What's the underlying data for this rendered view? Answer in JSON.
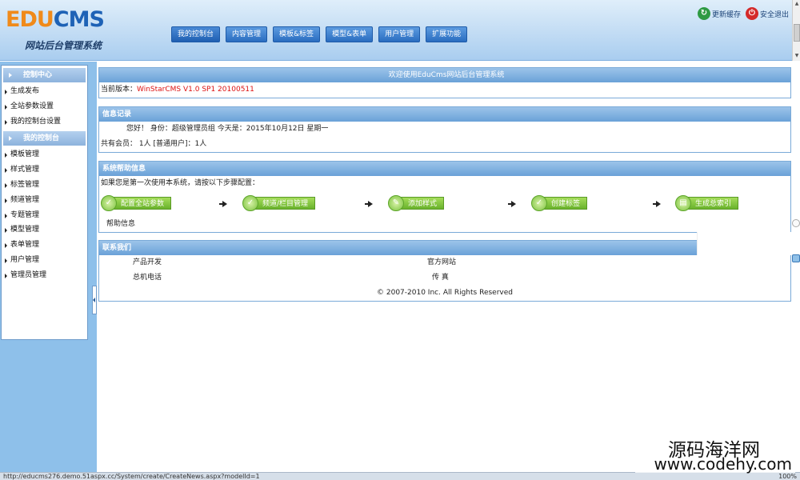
{
  "header": {
    "logo_edu": "EDU",
    "logo_cms": "CMS",
    "subtitle": "网站后台管理系统",
    "nav": [
      "我的控制台",
      "内容管理",
      "模板&标签",
      "模型&表单",
      "用户管理",
      "扩展功能"
    ],
    "refresh_label": "更新缓存",
    "logout_label": "安全退出",
    "refresh_icon": "refresh-icon",
    "logout_icon": "power-icon"
  },
  "sidebar": {
    "section1_title": "控制中心",
    "section1_items": [
      "生成发布",
      "全站参数设置",
      "我的控制台设置"
    ],
    "section2_title": "我的控制台",
    "section2_items": [
      "模板管理",
      "样式管理",
      "标签管理",
      "频道管理",
      "专题管理",
      "模型管理",
      "表单管理",
      "用户管理",
      "管理员管理"
    ]
  },
  "welcome": {
    "title": "欢迎使用EduCms网站后台管理系统",
    "version_label": "当前版本：",
    "version_value": "WinStarCMS V1.0 SP1 20100511"
  },
  "info": {
    "title": "信息记录",
    "greeting": "您好！ 身份：超级管理员组 今天是：2015年10月12日 星期一",
    "members": "共有会员： 1人 [普通用户]：1人"
  },
  "help": {
    "title": "系统帮助信息",
    "intro": "如果您是第一次使用本系统，请按以下步骤配置：",
    "steps": [
      "配置全站参数",
      "频道/栏目管理",
      "添加样式",
      "创建标签",
      "生成总索引"
    ],
    "help_link": "帮助信息"
  },
  "contact": {
    "title": "联系我们",
    "product_dev": "产品开发",
    "official_site": "官方网站",
    "phone": "总机电话",
    "fax": "传 真",
    "copyright": "© 2007-2010 Inc. All Rights Reserved"
  },
  "statusbar": {
    "url": "http://educms276.demo.51aspx.cc/System/create/CreateNews.aspx?modelId=1",
    "zoom": "100%"
  },
  "watermark": {
    "cn": "源码海洋网",
    "url": "www.codehy.com"
  },
  "colors": {
    "accent": "#2a6dc0",
    "panel_head": "#6aa1d8",
    "sidebar_bg": "#8ec0ea",
    "step_green": "#79c23c",
    "version_red": "#dd1111"
  }
}
